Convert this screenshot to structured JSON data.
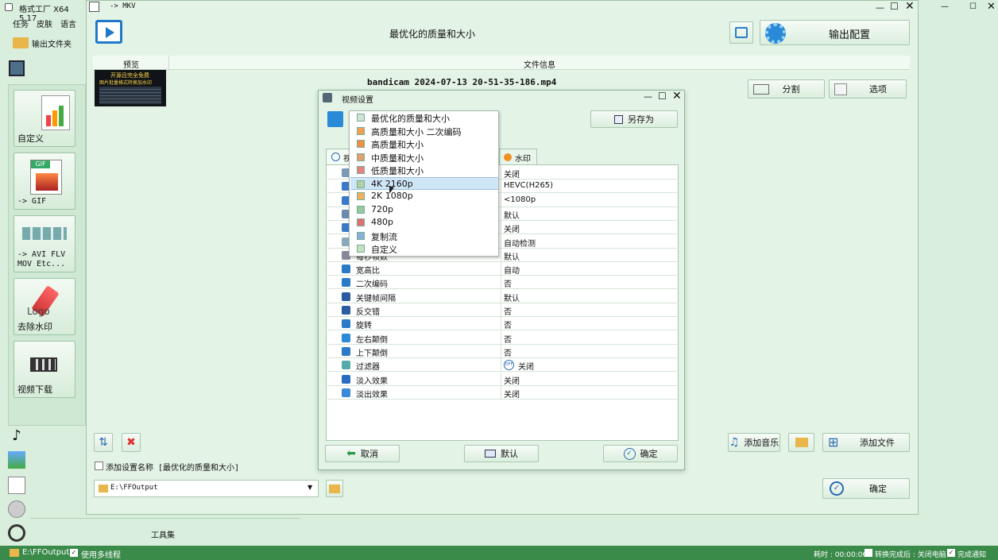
{
  "left_app": {
    "title": "格式工厂 X64 5.17",
    "menu": [
      "任务",
      "皮肤",
      "语言"
    ],
    "output_folder_button": "输出文件夹",
    "tiles": [
      {
        "label": "自定义"
      },
      {
        "label": "-> GIF"
      },
      {
        "label": "-> AVI FLV MOV Etc..."
      },
      {
        "label": "去除水印"
      },
      {
        "label": "视频下载"
      }
    ],
    "toolbox_label": "工具集"
  },
  "main_window": {
    "title": "-> MKV",
    "header_title": "最优化的质量和大小",
    "output_config_label": "输出配置",
    "col_preview": "预览",
    "col_fileinfo": "文件信息",
    "file_name": "bandicam 2024-07-13 20-51-35-186.mp4",
    "thumb_text1": "开源且完全免费",
    "thumb_text2": "图片批量格式转换加水印",
    "split_label": "分割",
    "options_label": "选项",
    "add_setting_label": "添加设置名称 [最优化的质量和大小]",
    "output_path": "E:\\FFOutput",
    "add_music_label": "添加音乐",
    "add_file_label": "添加文件",
    "ok_label": "确定"
  },
  "video_dialog": {
    "title": "视频设置",
    "save_as_label": "另存为",
    "tab_left_partial": "视",
    "tab_watermark": "水印",
    "rows": [
      {
        "name": "",
        "value": "关闭"
      },
      {
        "name": "",
        "value": "HEVC(H265)"
      },
      {
        "name": "",
        "value": "<1080p"
      },
      {
        "name": "",
        "value": "默认"
      },
      {
        "name": "",
        "value": "关闭"
      },
      {
        "name": "",
        "value": "自动检测"
      },
      {
        "name": "每秒帧数",
        "value": "默认"
      },
      {
        "name": "宽高比",
        "value": "自动"
      },
      {
        "name": "二次编码",
        "value": "否"
      },
      {
        "name": "关键帧间隔",
        "value": "默认"
      },
      {
        "name": "反交错",
        "value": "否"
      },
      {
        "name": "旋转",
        "value": "否"
      },
      {
        "name": "左右颠倒",
        "value": "否"
      },
      {
        "name": "上下颠倒",
        "value": "否"
      },
      {
        "name": "过滤器",
        "value": "关闭"
      },
      {
        "name": "淡入效果",
        "value": "关闭"
      },
      {
        "name": "淡出效果",
        "value": "关闭"
      }
    ],
    "filter_badge": "OFF",
    "cancel_label": "取消",
    "default_label": "默认",
    "ok_label": "确定",
    "dropdown": [
      "最优化的质量和大小",
      "高质量和大小 二次编码",
      "高质量和大小",
      "中质量和大小",
      "低质量和大小",
      "4K 2160p",
      "2K 1080p",
      "720p",
      "480p",
      "复制流",
      "自定义"
    ],
    "dropdown_highlighted_index": 5
  },
  "statusbar": {
    "path": "E:\\FFOutput",
    "multithread_label": "使用多线程",
    "elapsed": "耗时 : 00:00:06",
    "after_convert": "转换完成后 : 关闭电脑",
    "notify_label": "完成通知"
  },
  "colors": {
    "bg": "#d9eedd",
    "status_bar": "#3a8a4a",
    "accent_blue": "#1f6fd1",
    "highlight": "#cfe6f7"
  }
}
